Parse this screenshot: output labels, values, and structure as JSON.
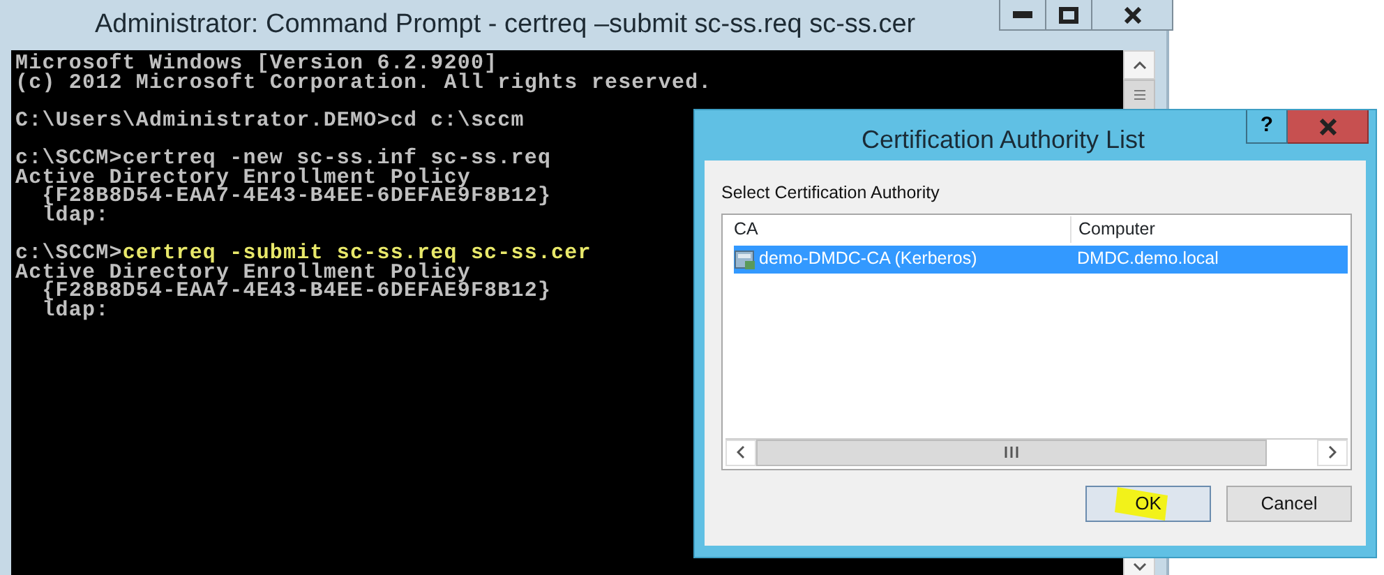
{
  "console_window": {
    "title": "Administrator: Command Prompt - certreq –submit sc-ss.req sc-ss.cer",
    "blocks": [
      [
        {
          "text": "Microsoft Windows [Version 6.2.9200]",
          "highlighted": false
        },
        {
          "text": "(c) 2012 Microsoft Corporation. All rights reserved.",
          "highlighted": false
        }
      ],
      [
        {
          "text": "C:\\Users\\Administrator.DEMO>cd c:\\sccm",
          "highlighted": false
        }
      ],
      [
        {
          "text": "c:\\SCCM>certreq -new sc-ss.inf sc-ss.req",
          "highlighted": false
        },
        {
          "text": "Active Directory Enrollment Policy",
          "highlighted": false
        },
        {
          "text": "  {F28B8D54-EAA7-4E43-B4EE-6DEFAE9F8B12}",
          "highlighted": false
        },
        {
          "text": "  ldap:",
          "highlighted": false
        }
      ],
      [
        {
          "prompt": "c:\\SCCM>",
          "text": "certreq -submit sc-ss.req sc-ss.cer",
          "highlighted": true
        },
        {
          "text": "Active Directory Enrollment Policy",
          "highlighted": false
        },
        {
          "text": "  {F28B8D54-EAA7-4E43-B4EE-6DEFAE9F8B12}",
          "highlighted": false
        },
        {
          "text": "  ldap:",
          "highlighted": false
        }
      ]
    ]
  },
  "dialog": {
    "title": "Certification Authority List",
    "help_button": "?",
    "label": "Select Certification Authority",
    "list": {
      "columns": [
        "CA",
        "Computer"
      ],
      "rows": [
        {
          "cells": [
            "demo-DMDC-CA (Kerberos)",
            "DMDC.demo.local"
          ],
          "selected": true
        }
      ]
    },
    "buttons": [
      {
        "label": "OK",
        "highlighted": true
      },
      {
        "label": "Cancel",
        "highlighted": false
      }
    ]
  }
}
